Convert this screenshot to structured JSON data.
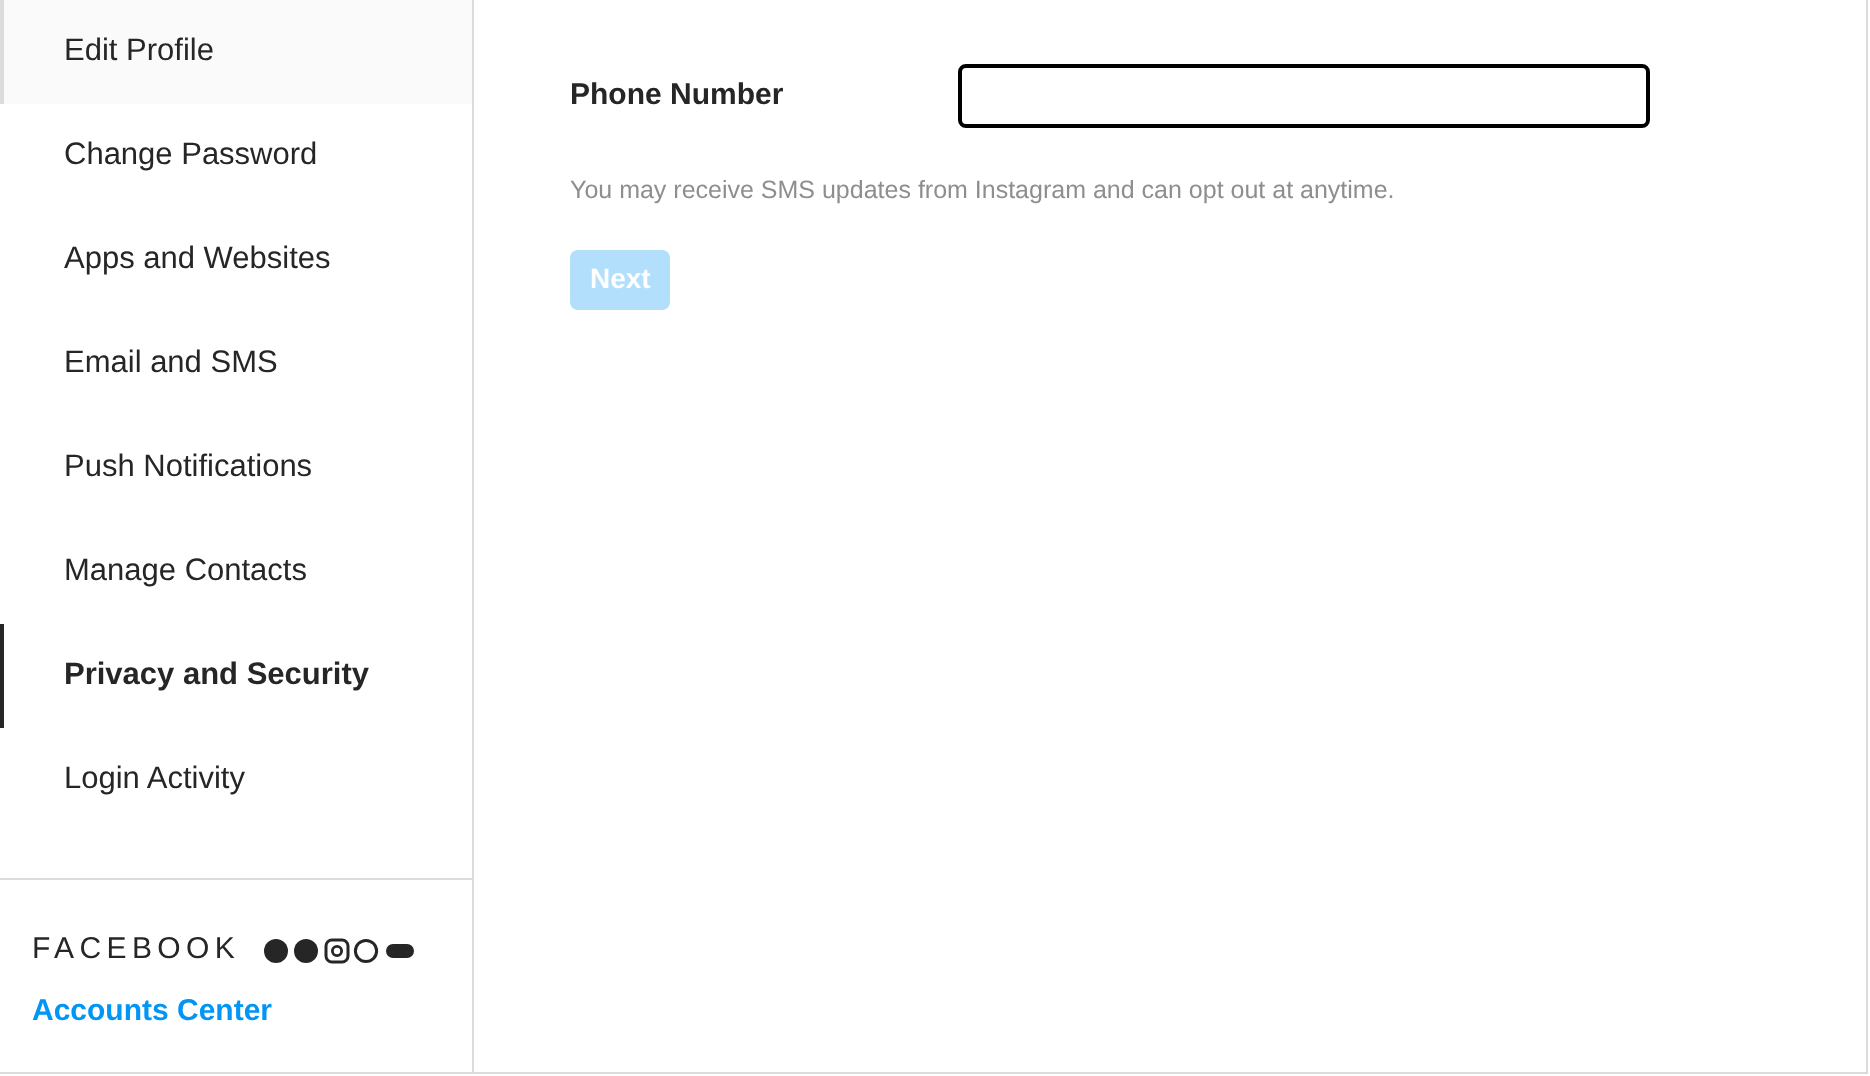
{
  "sidebar": {
    "items": [
      {
        "label": "Edit Profile",
        "selected": false,
        "highlighted": true
      },
      {
        "label": "Change Password",
        "selected": false,
        "highlighted": false
      },
      {
        "label": "Apps and Websites",
        "selected": false,
        "highlighted": false
      },
      {
        "label": "Email and SMS",
        "selected": false,
        "highlighted": false
      },
      {
        "label": "Push Notifications",
        "selected": false,
        "highlighted": false
      },
      {
        "label": "Manage Contacts",
        "selected": false,
        "highlighted": false
      },
      {
        "label": "Privacy and Security",
        "selected": true,
        "highlighted": false
      },
      {
        "label": "Login Activity",
        "selected": false,
        "highlighted": false
      }
    ],
    "footer": {
      "brand": "FACEBOOK",
      "link": "Accounts Center"
    }
  },
  "form": {
    "label": "Phone Number",
    "note": "You may receive SMS updates from Instagram and can opt out at anytime.",
    "button": {
      "label": "Next",
      "disabled": true
    }
  }
}
